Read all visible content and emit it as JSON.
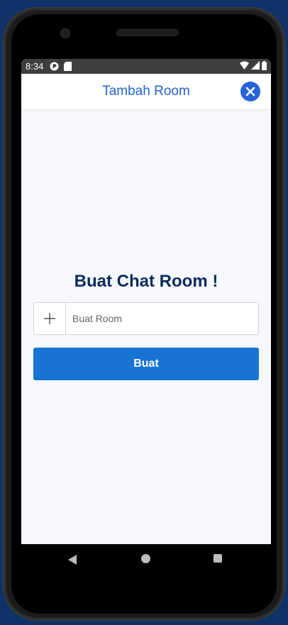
{
  "status_bar": {
    "time": "8:34",
    "icons_left": [
      "app-notification-icon",
      "sd-card-icon"
    ],
    "icons_right": [
      "wifi-icon",
      "signal-icon",
      "battery-icon"
    ]
  },
  "header": {
    "title": "Tambah Room",
    "close_icon": "close-icon"
  },
  "main": {
    "title": "Buat Chat Room !",
    "input": {
      "placeholder": "Buat Room",
      "value": "",
      "addon_icon": "plus-icon"
    },
    "submit_label": "Buat"
  },
  "nav_bar": {
    "buttons": [
      "back",
      "home",
      "recents"
    ]
  },
  "colors": {
    "background": "#0f3268",
    "header_title": "#2563c9",
    "close_button": "#2563d9",
    "page_title": "#0d2b5c",
    "primary_button": "#1874d2",
    "screen_background": "#f6f8fc"
  }
}
